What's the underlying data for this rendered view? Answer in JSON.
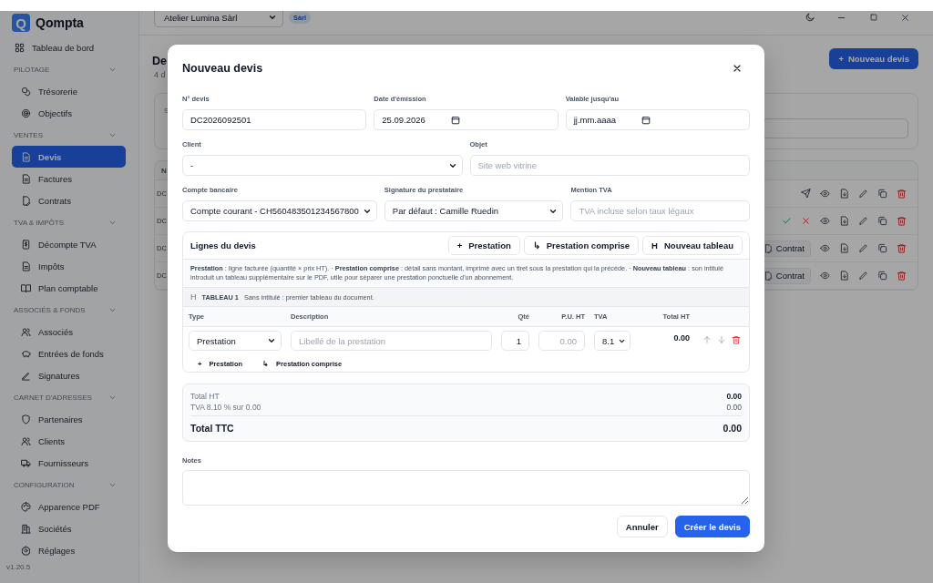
{
  "sidebar": {
    "brand": {
      "logo": "Q",
      "name": "Qompta"
    },
    "top_item": {
      "label": "Tableau de bord",
      "selected": false
    },
    "sections": [
      {
        "title": "PILOTAGE",
        "expanded": true,
        "items": [
          {
            "label": "Trésorerie",
            "selected": false
          },
          {
            "label": "Objectifs",
            "selected": false
          }
        ]
      },
      {
        "title": "VENTES",
        "expanded": true,
        "items": [
          {
            "label": "Devis",
            "selected": true
          },
          {
            "label": "Factures",
            "selected": false
          },
          {
            "label": "Contrats",
            "selected": false
          }
        ]
      },
      {
        "title": "TVA & IMPÔTS",
        "expanded": true,
        "items": [
          {
            "label": "Décompte TVA",
            "selected": false
          },
          {
            "label": "Impôts",
            "selected": false
          },
          {
            "label": "Plan comptable",
            "selected": false
          }
        ]
      },
      {
        "title": "ASSOCIÉS & FONDS",
        "expanded": true,
        "items": [
          {
            "label": "Associés",
            "selected": false
          },
          {
            "label": "Entrées de fonds",
            "selected": false
          },
          {
            "label": "Signatures",
            "selected": false
          }
        ]
      },
      {
        "title": "CARNET D'ADRESSES",
        "expanded": true,
        "items": [
          {
            "label": "Partenaires",
            "selected": false
          },
          {
            "label": "Clients",
            "selected": false
          },
          {
            "label": "Fournisseurs",
            "selected": false
          }
        ]
      },
      {
        "title": "CONFIGURATION",
        "expanded": true,
        "items": [
          {
            "label": "Apparence PDF",
            "selected": false
          },
          {
            "label": "Sociétés",
            "selected": false
          },
          {
            "label": "Réglages",
            "selected": false
          }
        ]
      }
    ],
    "version": "v1.20.5"
  },
  "topbar": {
    "company": "Atelier Lumina Sàrl",
    "company_badge": "Sàrl"
  },
  "page": {
    "title": "De",
    "subtitle": "4 d",
    "new_button": {
      "icon": "+",
      "label": "Nouveau devis"
    },
    "search_label": "S",
    "table": {
      "header": "N",
      "rows": [
        {
          "cell": "DC",
          "actions": [
            {
              "kind": "send"
            },
            {
              "kind": "view"
            },
            {
              "kind": "pdf"
            },
            {
              "kind": "edit"
            },
            {
              "kind": "copy"
            },
            {
              "kind": "delete"
            }
          ]
        },
        {
          "cell": "DC",
          "actions": [
            {
              "kind": "accept"
            },
            {
              "kind": "reject"
            },
            {
              "kind": "view"
            },
            {
              "kind": "pdf"
            },
            {
              "kind": "edit"
            },
            {
              "kind": "copy"
            },
            {
              "kind": "delete"
            }
          ]
        },
        {
          "cell": "DC",
          "contract_button": "Contrat",
          "actions": [
            {
              "kind": "view"
            },
            {
              "kind": "pdf"
            },
            {
              "kind": "edit"
            },
            {
              "kind": "copy"
            },
            {
              "kind": "delete"
            }
          ]
        },
        {
          "cell": "DC",
          "contract_button": "Contrat",
          "actions": [
            {
              "kind": "view"
            },
            {
              "kind": "pdf"
            },
            {
              "kind": "edit"
            },
            {
              "kind": "copy"
            },
            {
              "kind": "delete"
            }
          ]
        }
      ]
    }
  },
  "dialog": {
    "title": "Nouveau devis",
    "field_rows": [
      [
        {
          "label": "N° devis",
          "kind": "text",
          "value": "DC2026092501"
        },
        {
          "label": "Date d'émission",
          "kind": "date",
          "value": "25.09.2026"
        },
        {
          "label": "Valable jusqu'au",
          "kind": "date",
          "placeholder": "jj.mm.aaaa"
        }
      ],
      [
        {
          "label": "Client",
          "kind": "select",
          "value": "-"
        },
        {
          "label": "Objet",
          "kind": "text",
          "placeholder": "Site web vitrine"
        }
      ],
      [
        {
          "label": "Compte bancaire",
          "kind": "select",
          "value": "Compte courant - CH560483501234567800"
        },
        {
          "label": "Signature du prestataire",
          "kind": "select",
          "value": "Par défaut : Camille Ruedin"
        },
        {
          "label": "Mention TVA",
          "kind": "text",
          "placeholder": "TVA incluse selon taux légaux"
        }
      ]
    ],
    "lines": {
      "title": "Lignes du devis",
      "buttons": [
        {
          "icon": "+",
          "label": "Prestation"
        },
        {
          "icon": "↳",
          "label": "Prestation comprise"
        },
        {
          "icon": "H",
          "label": "Nouveau tableau"
        }
      ],
      "help": "**Prestation** : ligne facturée (quantité × prix HT). · **Prestation comprise** : détail sans montant, imprimé avec un tiret sous la prestation qui la précède. · **Nouveau tableau** : son intitulé introduit un tableau supplémentaire sur le PDF, utile pour séparer une prestation ponctuelle d'un abonnement.",
      "table_header": {
        "icon": "H",
        "name": "TABLEAU 1",
        "caption": "Sans intitulé : premier tableau du document."
      },
      "columns": [
        "Type",
        "Description",
        "Qté",
        "P.U. HT",
        "TVA",
        "Total HT"
      ],
      "rows": [
        {
          "type": "Prestation",
          "description_placeholder": "Libellé de la prestation",
          "quantity": "1",
          "unit_price_placeholder": "0.00",
          "vat": "8.1",
          "total": "0.00"
        }
      ],
      "add_buttons": [
        {
          "icon": "+",
          "label": "Prestation"
        },
        {
          "icon": "↳",
          "label": "Prestation comprise"
        }
      ]
    },
    "totals": [
      {
        "kind": "subtotal",
        "label": "Total HT",
        "value": "0.00"
      },
      {
        "kind": "tax",
        "label": "TVA 8.10 % sur 0.00",
        "value": "0.00"
      },
      {
        "kind": "grand",
        "label": "Total TTC",
        "value": "0.00"
      }
    ],
    "notes": {
      "label": "Notes"
    },
    "footer_buttons": [
      {
        "kind": "secondary",
        "label": "Annuler"
      },
      {
        "kind": "primary",
        "label": "Créer le devis"
      }
    ]
  }
}
